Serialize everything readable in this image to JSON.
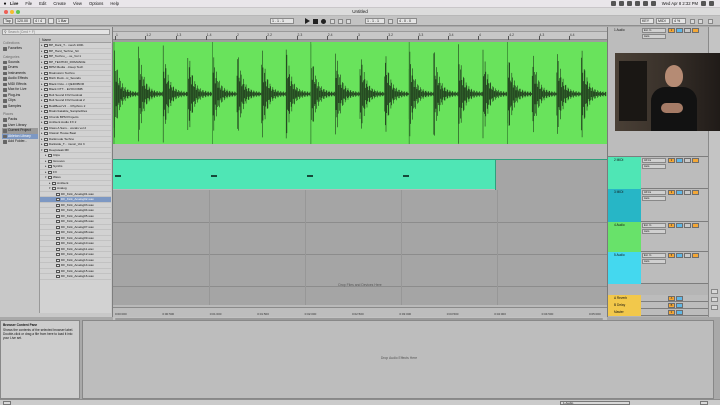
{
  "menubar": {
    "apple": "",
    "items": [
      "Live",
      "File",
      "Edit",
      "Create",
      "View",
      "Options",
      "Help"
    ],
    "clock": "Wed Apr 8  2:32 PM"
  },
  "window": {
    "title": "Untitled"
  },
  "transport": {
    "tap": "Tap",
    "tempo": "120.00",
    "signature": "4 / 4",
    "metronome": "",
    "quantize": "1 Bar",
    "position": "1 . 1 . 1",
    "loop_start": "1 . 1 . 1",
    "loop_length": "4 . 0 . 0",
    "key": "KEY",
    "midi": "MIDI",
    "cpu": "4 %"
  },
  "browser": {
    "search_placeholder": "Search (Cmd + F)",
    "collections_header": "Collections",
    "collections": [
      {
        "label": "Favorites"
      }
    ],
    "categories_header": "Categories",
    "categories": [
      {
        "label": "Sounds"
      },
      {
        "label": "Drums"
      },
      {
        "label": "Instruments"
      },
      {
        "label": "Audio Effects"
      },
      {
        "label": "MIDI Effects"
      },
      {
        "label": "Max for Live"
      },
      {
        "label": "Plug-ins"
      },
      {
        "label": "Clips"
      },
      {
        "label": "Samples"
      }
    ],
    "places_header": "Places",
    "places": [
      {
        "label": "Packs"
      },
      {
        "label": "User Library"
      },
      {
        "label": "Current Project"
      },
      {
        "label": "Ableton Library"
      },
      {
        "label": "Add Folder..."
      }
    ],
    "files_header": "Name",
    "files": [
      {
        "label": "BP_Dark_T... mesh 100b",
        "depth": 0,
        "expand": "▸"
      },
      {
        "label": "BP_Hard_Techno_Str",
        "depth": 0,
        "expand": "▸"
      },
      {
        "label": "BP_Techno_...ve_Vol 1",
        "depth": 0,
        "expand": "▸"
      },
      {
        "label": "BP_TECHNO_ROMANCE",
        "depth": 0,
        "expand": "▸"
      },
      {
        "label": "BPM Media ...Deep Tech",
        "depth": 0,
        "expand": "▸"
      },
      {
        "label": "Brainstorm Techno",
        "depth": 0,
        "expand": "▸"
      },
      {
        "label": "Bitch Rock...ic_Sounds",
        "depth": 0,
        "expand": "▸"
      },
      {
        "label": "Black Octo...t QEDOBOR",
        "depth": 0,
        "expand": "▸"
      },
      {
        "label": "Black OTT... EVOCOMB",
        "depth": 0,
        "expand": "▸"
      },
      {
        "label": "Bolt Sound FX2 Festival",
        "depth": 0,
        "expand": "▸"
      },
      {
        "label": "Bolt Sound FX2 Festival 2",
        "depth": 0,
        "expand": "▸"
      },
      {
        "label": "BoldBeat V2 ... Rhythms 2",
        "depth": 0,
        "expand": "▸"
      },
      {
        "label": "Brainzzakable_SampleFiles",
        "depth": 0,
        "expand": "▸"
      },
      {
        "label": "Chords BPM Projects",
        "depth": 0,
        "expand": "▸"
      },
      {
        "label": "Ambient Audio FX 2",
        "depth": 0,
        "expand": "▸"
      },
      {
        "label": "Class A Sam... vocals vol 2",
        "depth": 0,
        "expand": "▸"
      },
      {
        "label": "Classic House Beat",
        "depth": 0,
        "expand": "▸"
      },
      {
        "label": "Darkmode Techno",
        "depth": 0,
        "expand": "▸"
      },
      {
        "label": "Darkside_T... music_Vol 3",
        "depth": 0,
        "expand": "▸"
      },
      {
        "label": "Deepsteak MF",
        "depth": 0,
        "expand": "▾"
      },
      {
        "label": "Clips",
        "depth": 1,
        "expand": "▸"
      },
      {
        "label": "Grooves",
        "depth": 1,
        "expand": "▸"
      },
      {
        "label": "Synths",
        "depth": 1,
        "expand": "▸"
      },
      {
        "label": "FX",
        "depth": 1,
        "expand": "▸"
      },
      {
        "label": "Wavs",
        "depth": 1,
        "expand": "▾"
      },
      {
        "label": "Ambient",
        "depth": 2,
        "expand": "▸"
      },
      {
        "label": "Analog",
        "depth": 2,
        "expand": "▾"
      },
      {
        "label": "DF_Kick_Analog01.wav",
        "depth": 3,
        "expand": ""
      },
      {
        "label": "DF_Kick_Analog02.wav",
        "depth": 3,
        "expand": ""
      },
      {
        "label": "DF_Kick_Analog03.wav",
        "depth": 3,
        "expand": ""
      },
      {
        "label": "DF_Kick_Analog04.wav",
        "depth": 3,
        "expand": ""
      },
      {
        "label": "DF_Kick_Analog05.wav",
        "depth": 3,
        "expand": ""
      },
      {
        "label": "DF_Kick_Analog06.wav",
        "depth": 3,
        "expand": ""
      },
      {
        "label": "DF_Kick_Analog07.wav",
        "depth": 3,
        "expand": ""
      },
      {
        "label": "DF_Kick_Analog08.wav",
        "depth": 3,
        "expand": ""
      },
      {
        "label": "DF_Kick_Analog09.wav",
        "depth": 3,
        "expand": ""
      },
      {
        "label": "DF_Kick_Analog10.wav",
        "depth": 3,
        "expand": ""
      },
      {
        "label": "DF_Kick_Analog11.wav",
        "depth": 3,
        "expand": ""
      },
      {
        "label": "DF_Kick_Analog12.wav",
        "depth": 3,
        "expand": ""
      },
      {
        "label": "DF_Kick_Analog13.wav",
        "depth": 3,
        "expand": ""
      },
      {
        "label": "DF_Kick_Analog14.wav",
        "depth": 3,
        "expand": ""
      },
      {
        "label": "DF_Kick_Analog15.wav",
        "depth": 3,
        "expand": ""
      },
      {
        "label": "DF_Kick_Analog16.wav",
        "depth": 3,
        "expand": ""
      }
    ],
    "selected_file_index": 28
  },
  "arrangement": {
    "bars": [
      "1",
      "1.2",
      "1.3",
      "1.4",
      "2",
      "2.2",
      "2.3",
      "2.4",
      "3",
      "3.2",
      "3.3",
      "3.4",
      "4",
      "4.2",
      "4.3",
      "4.4"
    ],
    "times": [
      "0:00:000",
      "0:00:500",
      "0:01:000",
      "0:01:500",
      "0:02:000",
      "0:02:500",
      "0:03:000",
      "0:03:500",
      "0:04:000",
      "0:04:500",
      "0:05:000"
    ],
    "drop_hint": "Drop Files and Devices Here",
    "audio_color": "#69e35c",
    "midi_color": "#4fe6b5",
    "kick_count": 20,
    "midi_notes": 4
  },
  "tracks": [
    {
      "name": "1 Audio",
      "color": "#69e35c",
      "input": "Ext. In",
      "monitor": "Auto",
      "num": "1"
    },
    {
      "name": "2 MIDI",
      "color": "#4fe6b5",
      "input": "All Ins",
      "monitor": "Auto",
      "num": "2"
    },
    {
      "name": "3 MIDI",
      "color": "#27b6c6",
      "input": "All Ins",
      "monitor": "Auto",
      "num": "3"
    },
    {
      "name": "4 Audio",
      "color": "#68e26a",
      "input": "Ext. In",
      "monitor": "Auto",
      "num": "4"
    },
    {
      "name": "5 Audio",
      "color": "#44d8ef",
      "input": "Ext. In",
      "monitor": "Auto",
      "num": "5"
    }
  ],
  "returns": [
    {
      "name": "A Reverb",
      "num": "A"
    },
    {
      "name": "B Delay",
      "num": "B"
    },
    {
      "name": "Master",
      "num": "0"
    }
  ],
  "info_view": {
    "title": "Browser Content Pane",
    "body": "Shows the contents of the selected browser label. Double-click or drag a file from here to load it into your Live set."
  },
  "device_view": {
    "hint": "Drop Audio Effects Here"
  },
  "status": {
    "track_label": "1-Audio"
  }
}
